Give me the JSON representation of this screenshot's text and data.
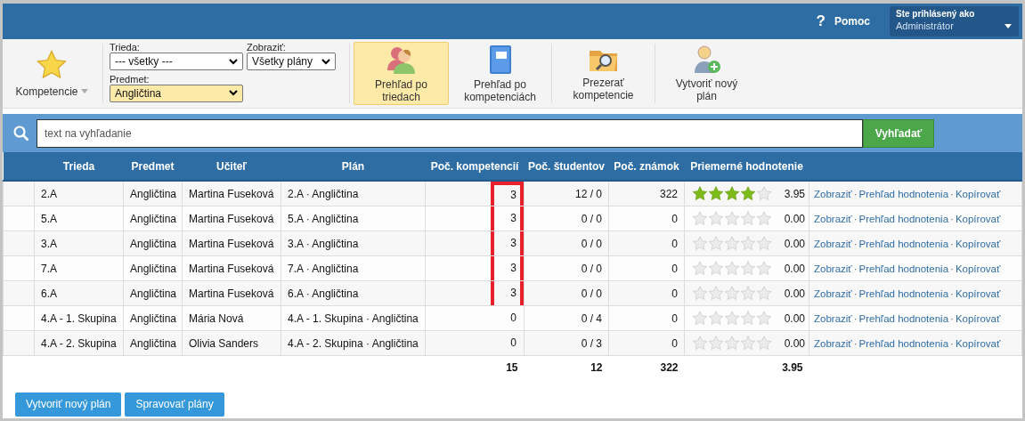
{
  "header": {
    "help": "Pomoc",
    "help_icon": "?",
    "user_label": "Ste prihlásený ako",
    "user_value": "Administrátor"
  },
  "toolbar": {
    "menu": "Kompetencie",
    "filters": [
      {
        "label": "Trieda:",
        "value": "--- všetky ---",
        "highlighted": false
      },
      {
        "label": "Zobraziť:",
        "value": "Všetky plány",
        "highlighted": false
      },
      {
        "label": "Predmet:",
        "value": "Angličtina",
        "highlighted": true
      }
    ],
    "buttons": [
      {
        "kind": "class",
        "label": "Prehľad po triedach",
        "selected": true
      },
      {
        "kind": "book",
        "label": "Prehľad po kompetenciách",
        "selected": false
      },
      {
        "kind": "folder",
        "label": "Prezerať kompetencie",
        "selected": false
      },
      {
        "kind": "add",
        "label": "Vytvoriť nový plán",
        "selected": false
      }
    ]
  },
  "search": {
    "placeholder": "text na vyhľadanie",
    "button": "Vyhľadať"
  },
  "table": {
    "columns": [
      "Trieda",
      "Predmet",
      "Učiteľ",
      "Plán",
      "Poč. kompetencií",
      "Poč. študentov",
      "Poč. známok",
      "Priemerné hodnotenie"
    ],
    "rows": [
      {
        "trieda": "2.A",
        "predmet": "Angličtina",
        "ucitel": "Martina Fuseková",
        "plan": "2.A · Angličtina",
        "kompetencie": "3",
        "highlighted": true,
        "studenti": "12 / 0",
        "znamky": "322",
        "stars": 4,
        "hodnotenie": "3.95",
        "actions": [
          {
            "kind": "link",
            "text": "Zobraziť"
          },
          {
            "kind": "separator",
            "text": "·"
          },
          {
            "kind": "link",
            "text": "Prehľad hodnotenia"
          },
          {
            "kind": "separator",
            "text": "·"
          },
          {
            "kind": "link",
            "text": "Kopírovať"
          }
        ]
      },
      {
        "trieda": "5.A",
        "predmet": "Angličtina",
        "ucitel": "Martina Fuseková",
        "plan": "5.A · Angličtina",
        "kompetencie": "3",
        "highlighted": true,
        "studenti": "0 / 0",
        "znamky": "0",
        "stars": 0,
        "hodnotenie": "0.00",
        "actions": [
          {
            "kind": "link",
            "text": "Zobraziť"
          },
          {
            "kind": "separator",
            "text": "·"
          },
          {
            "kind": "link",
            "text": "Prehľad hodnotenia"
          },
          {
            "kind": "separator",
            "text": "·"
          },
          {
            "kind": "link",
            "text": "Kopírovať"
          }
        ]
      },
      {
        "trieda": "3.A",
        "predmet": "Angličtina",
        "ucitel": "Martina Fuseková",
        "plan": "3.A · Angličtina",
        "kompetencie": "3",
        "highlighted": true,
        "studenti": "0 / 0",
        "znamky": "0",
        "stars": 0,
        "hodnotenie": "0.00",
        "actions": [
          {
            "kind": "link",
            "text": "Zobraziť"
          },
          {
            "kind": "separator",
            "text": "·"
          },
          {
            "kind": "link",
            "text": "Prehľad hodnotenia"
          },
          {
            "kind": "separator",
            "text": "·"
          },
          {
            "kind": "link",
            "text": "Kopírovať"
          }
        ]
      },
      {
        "trieda": "7.A",
        "predmet": "Angličtina",
        "ucitel": "Martina Fuseková",
        "plan": "7.A · Angličtina",
        "kompetencie": "3",
        "highlighted": true,
        "studenti": "0 / 0",
        "znamky": "0",
        "stars": 0,
        "hodnotenie": "0.00",
        "actions": [
          {
            "kind": "link",
            "text": "Zobraziť"
          },
          {
            "kind": "separator",
            "text": "·"
          },
          {
            "kind": "link",
            "text": "Prehľad hodnotenia"
          },
          {
            "kind": "separator",
            "text": "·"
          },
          {
            "kind": "link",
            "text": "Kopírovať"
          }
        ]
      },
      {
        "trieda": "6.A",
        "predmet": "Angličtina",
        "ucitel": "Martina Fuseková",
        "plan": "6.A · Angličtina",
        "kompetencie": "3",
        "highlighted": true,
        "studenti": "0 / 0",
        "znamky": "0",
        "stars": 0,
        "hodnotenie": "0.00",
        "actions": [
          {
            "kind": "link",
            "text": "Zobraziť"
          },
          {
            "kind": "separator",
            "text": "·"
          },
          {
            "kind": "link",
            "text": "Prehľad hodnotenia"
          },
          {
            "kind": "separator",
            "text": "·"
          },
          {
            "kind": "link",
            "text": "Kopírovať"
          }
        ]
      },
      {
        "trieda": "4.A - 1. Skupina",
        "predmet": "Angličtina",
        "ucitel": "Mária Nová",
        "plan": "4.A - 1. Skupina · Angličtina",
        "kompetencie": "0",
        "highlighted": false,
        "studenti": "0 / 4",
        "znamky": "0",
        "stars": 0,
        "hodnotenie": "0.00",
        "actions": [
          {
            "kind": "link",
            "text": "Zobraziť"
          },
          {
            "kind": "separator",
            "text": "·"
          },
          {
            "kind": "link",
            "text": "Prehľad hodnotenia"
          },
          {
            "kind": "separator",
            "text": "·"
          },
          {
            "kind": "link",
            "text": "Kopírovať"
          }
        ]
      },
      {
        "trieda": "4.A - 2. Skupina",
        "predmet": "Angličtina",
        "ucitel": "Olivia Sanders",
        "plan": "4.A - 2. Skupina · Angličtina",
        "kompetencie": "0",
        "highlighted": false,
        "studenti": "0 / 3",
        "znamky": "0",
        "stars": 0,
        "hodnotenie": "0.00",
        "actions": [
          {
            "kind": "link",
            "text": "Zobraziť"
          },
          {
            "kind": "separator",
            "text": "·"
          },
          {
            "kind": "link",
            "text": "Prehľad hodnotenia"
          },
          {
            "kind": "separator",
            "text": "·"
          },
          {
            "kind": "link",
            "text": "Kopírovať"
          }
        ]
      }
    ],
    "totals": {
      "kompetencie": "15",
      "studenti": "12",
      "znamky": "322",
      "hodnotenie": "3.95"
    }
  },
  "buttons": [
    "Vytvoriť nový plán",
    "Spravovať plány"
  ]
}
